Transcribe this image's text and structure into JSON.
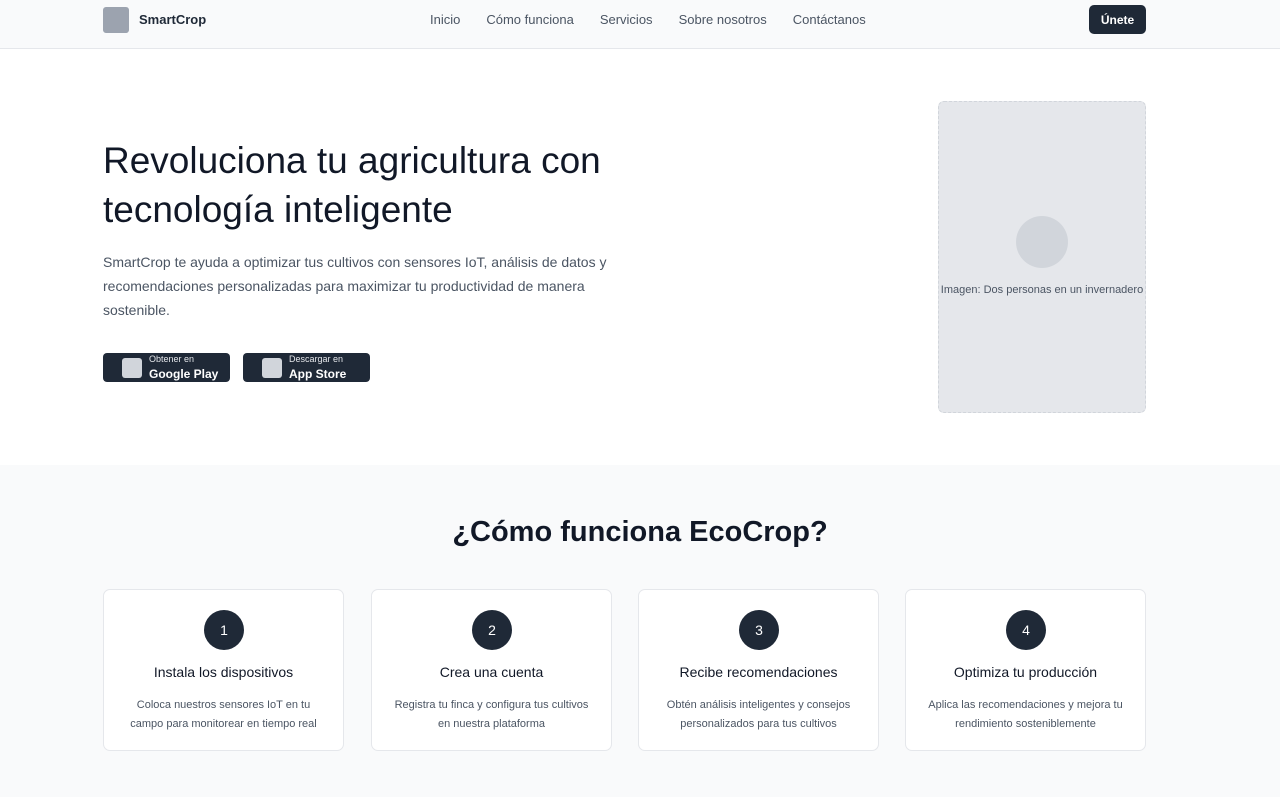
{
  "nav": {
    "brand": "SmartCrop",
    "links": [
      "Inicio",
      "Cómo funciona",
      "Servicios",
      "Sobre nosotros",
      "Contáctanos"
    ],
    "join_label": "Únete"
  },
  "hero": {
    "title": "Revoluciona tu agricultura con tecnología inteligente",
    "description": "SmartCrop te ayuda a optimizar tus cultivos con sensores IoT, análisis de datos y recomendaciones personalizadas para maximizar tu productividad de manera sostenible.",
    "google_play": {
      "small": "Obtener en",
      "big": "Google Play"
    },
    "app_store": {
      "small": "Descargar en",
      "big": "App Store"
    },
    "image_caption": "Imagen: Dos personas en un invernadero"
  },
  "how": {
    "title": "¿Cómo funciona EcoCrop?",
    "steps": [
      {
        "num": "1",
        "title": "Instala los dispositivos",
        "desc": "Coloca nuestros sensores IoT en tu campo para monitorear en tiempo real"
      },
      {
        "num": "2",
        "title": "Crea una cuenta",
        "desc": "Registra tu finca y configura tus cultivos en nuestra plataforma"
      },
      {
        "num": "3",
        "title": "Recibe recomendaciones",
        "desc": "Obtén análisis inteligentes y consejos personalizados para tus cultivos"
      },
      {
        "num": "4",
        "title": "Optimiza tu producción",
        "desc": "Aplica las recomendaciones y mejora tu rendimiento sosteniblemente"
      }
    ]
  },
  "colors": {
    "primary": "#1f2937",
    "muted": "#4b5563",
    "placeholder": "#e5e7eb"
  }
}
